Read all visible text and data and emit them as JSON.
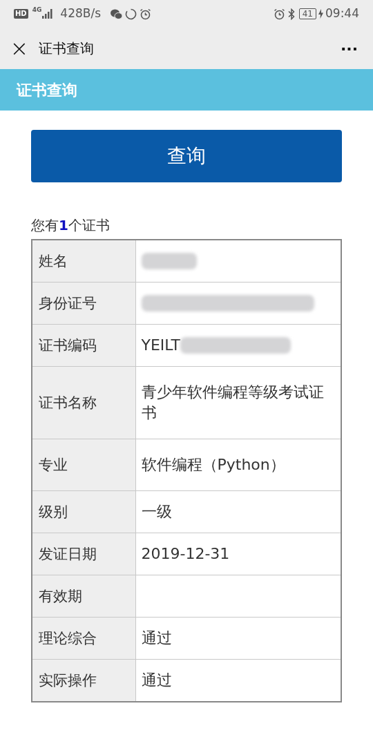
{
  "status_bar": {
    "hd": "HD",
    "network": "4G",
    "speed": "428B/s",
    "battery": "41",
    "time": "09:44"
  },
  "title_bar": {
    "title": "证书查询",
    "close": "×",
    "more": "···"
  },
  "banner": {
    "title": "证书查询"
  },
  "query_button": "查询",
  "summary": "您有**1**个证书",
  "rows": [
    {
      "label": "姓名",
      "redacted": true
    },
    {
      "label": "身份证号",
      "redacted": true
    },
    {
      "label": "证书编码",
      "value": "YEILT",
      "redacted": true
    },
    {
      "label": "证书名称",
      "value": "青少年软件编程等级考试证书",
      "redacted": false
    },
    {
      "label": "专业",
      "value": "软件编程（Python）",
      "redacted": false
    },
    {
      "label": "级别",
      "value": "一级",
      "redacted": false
    },
    {
      "label": "发证日期",
      "value": "2019-12-31",
      "redacted": false
    },
    {
      "label": "有效期",
      "redacted": false
    },
    {
      "label": "理论综合",
      "value": "通过",
      "redacted": false
    },
    {
      "label": "实际操作",
      "value": "通过",
      "redacted": false
    }
  ]
}
